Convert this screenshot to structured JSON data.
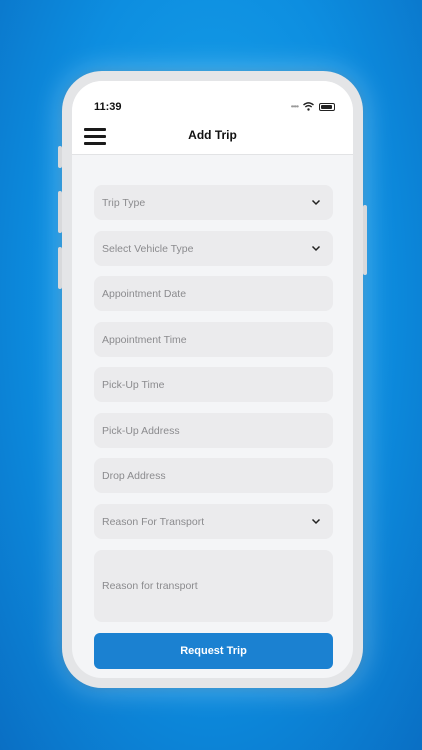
{
  "status": {
    "time": "11:39"
  },
  "header": {
    "title": "Add Trip"
  },
  "form": {
    "trip_type": {
      "placeholder": "Trip Type"
    },
    "vehicle_type": {
      "placeholder": "Select Vehicle Type"
    },
    "appointment_date": {
      "placeholder": "Appointment Date"
    },
    "appointment_time": {
      "placeholder": "Appointment Time"
    },
    "pickup_time": {
      "placeholder": "Pick-Up Time"
    },
    "pickup_address": {
      "placeholder": "Pick-Up Address"
    },
    "drop_address": {
      "placeholder": "Drop Address"
    },
    "reason_select": {
      "placeholder": "Reason For Transport"
    },
    "reason_text": {
      "placeholder": "Reason for transport"
    },
    "submit_label": "Request Trip"
  },
  "colors": {
    "background": "#0d8ee0",
    "primary_button": "#1b81d1",
    "field_bg": "#ebebed"
  }
}
